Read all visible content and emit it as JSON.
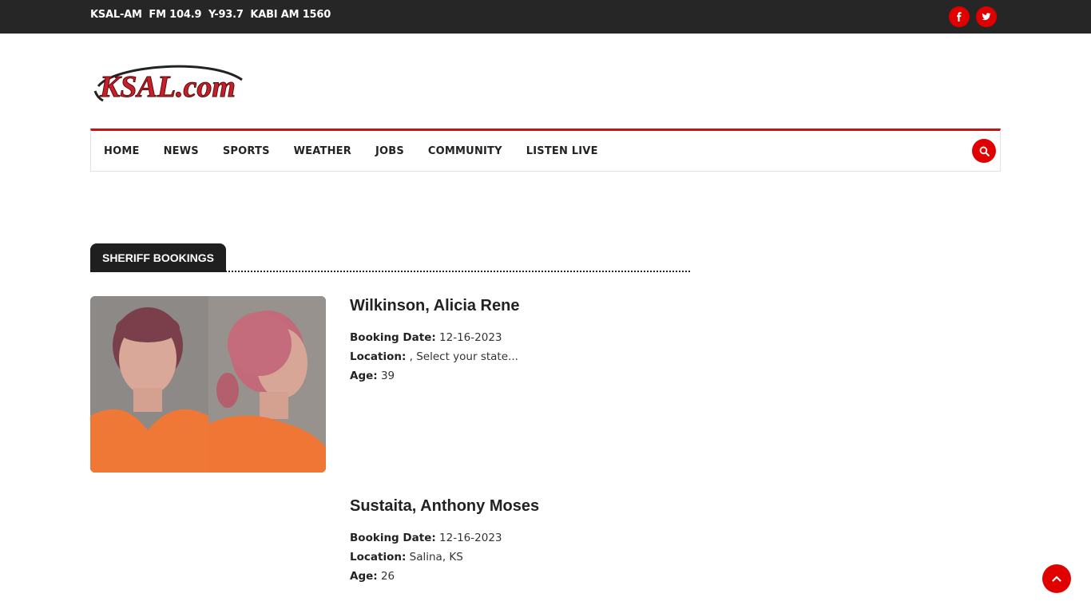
{
  "topbar": {
    "stations": "KSAL-AM  FM 104.9  Y-93.7  KABI AM 1560",
    "social": [
      "facebook-icon",
      "twitter-icon"
    ]
  },
  "logo": {
    "text": "KSAL.com",
    "brand_color": "#c8202a"
  },
  "nav": {
    "items": [
      "HOME",
      "NEWS",
      "SPORTS",
      "WEATHER",
      "JOBS",
      "COMMUNITY",
      "LISTEN LIVE"
    ],
    "search_icon": "search-icon",
    "accent": "#cc1111"
  },
  "section": {
    "title": "SHERIFF BOOKINGS"
  },
  "bookings": [
    {
      "name": "Wilkinson, Alicia Rene",
      "booking_date_label": "Booking Date:",
      "booking_date": "12-16-2023",
      "location_label": "Location:",
      "location": ", Select your state...",
      "age_label": "Age:",
      "age": "39"
    },
    {
      "name": "Sustaita, Anthony Moses",
      "booking_date_label": "Booking Date:",
      "booking_date": "12-16-2023",
      "location_label": "Location:",
      "location": "Salina, KS",
      "age_label": "Age:",
      "age": "26"
    }
  ],
  "back_to_top_icon": "chevron-up-icon"
}
